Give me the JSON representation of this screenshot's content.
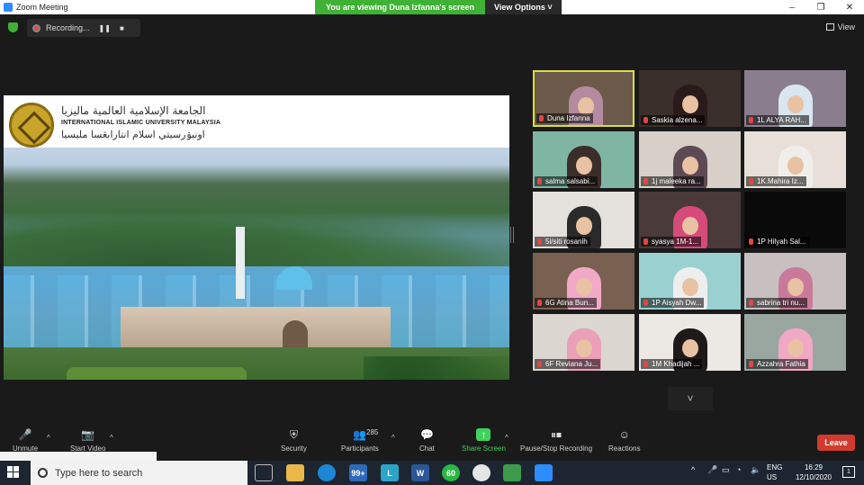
{
  "window": {
    "title": "Zoom Meeting",
    "controls": [
      "–",
      "❐",
      "✕"
    ]
  },
  "banner": {
    "viewing_text": "You are viewing Duna Izfanna's screen",
    "view_options": "View Options ˅"
  },
  "recording": {
    "label": "Recording...",
    "pause": "❚❚",
    "stop": "■"
  },
  "view_button": "View",
  "shared_screen": {
    "university_arabic": "الجامعة الإسلامية العالمية ماليزيا",
    "university_english": "INTERNATIONAL ISLAMIC UNIVERSITY MALAYSIA",
    "university_malay_jawi": "اونيۏرسيتي اسلام انتارابڠسا مليسيا"
  },
  "gallery": {
    "participants": [
      {
        "name": "Duna Izfanna",
        "bg": "#6b5a4a",
        "hijab": "#b48aa0"
      },
      {
        "name": "Saskia alzena...",
        "bg": "#3a2f2a",
        "hijab": "#2a1a1a"
      },
      {
        "name": "1L ALYA RAH...",
        "bg": "#8a7e8e",
        "hijab": "#d9e6ef"
      },
      {
        "name": "salma salsabi...",
        "bg": "#7fb6a3",
        "hijab": "#3b2e2a"
      },
      {
        "name": "1j maleeka ra...",
        "bg": "#d8d0c8",
        "hijab": "#5e4a54"
      },
      {
        "name": "1K.Mahira Iz...",
        "bg": "#e8e0d8",
        "hijab": "#f0eeea"
      },
      {
        "name": "5i/siti rosanih",
        "bg": "#e4e0dc",
        "hijab": "#2a2a2a"
      },
      {
        "name": "syasya 1M-1...",
        "bg": "#4a3a3a",
        "hijab": "#d64a7a"
      },
      {
        "name": "1P Hilyah Sal...",
        "bg": "#0a0a0a",
        "hijab": "#0a0a0a"
      },
      {
        "name": "6G Atina Bun...",
        "bg": "#7a6050",
        "hijab": "#f2a9c8"
      },
      {
        "name": "1P Aisyah Dw...",
        "bg": "#9ad0d0",
        "hijab": "#eeeeee"
      },
      {
        "name": "sabrina tri nu...",
        "bg": "#c8c0c0",
        "hijab": "#c97a9a"
      },
      {
        "name": "6F Reviana Ju...",
        "bg": "#dcd6d0",
        "hijab": "#e9a0b8"
      },
      {
        "name": "1M Khadijah ...",
        "bg": "#ece8e4",
        "hijab": "#1e1a1a"
      },
      {
        "name": "Azzahra Fathia",
        "bg": "#9aa6a0",
        "hijab": "#f0a8c4"
      }
    ],
    "scroll_down": "˅"
  },
  "toolbar": {
    "unmute": "Unmute",
    "start_video": "Start Video",
    "security": "Security",
    "participants": "Participants",
    "participants_count": "285",
    "chat": "Chat",
    "share_screen": "Share Screen",
    "pause_stop_recording": "Pause/Stop Recording",
    "reactions": "Reactions",
    "leave": "Leave",
    "caret": "^"
  },
  "taskbar": {
    "search_placeholder": "Type here to search",
    "mail_badge": "99+",
    "whatsapp_badge": "60",
    "lang_primary": "ENG",
    "lang_secondary": "US",
    "time": "16:29",
    "date": "12/10/2020",
    "notification_count": "1",
    "tray_chevron": "^"
  },
  "colors": {
    "accent_green": "#3fb135",
    "leave_red": "#d33a2e",
    "zoom_blue": "#2d8cff"
  }
}
